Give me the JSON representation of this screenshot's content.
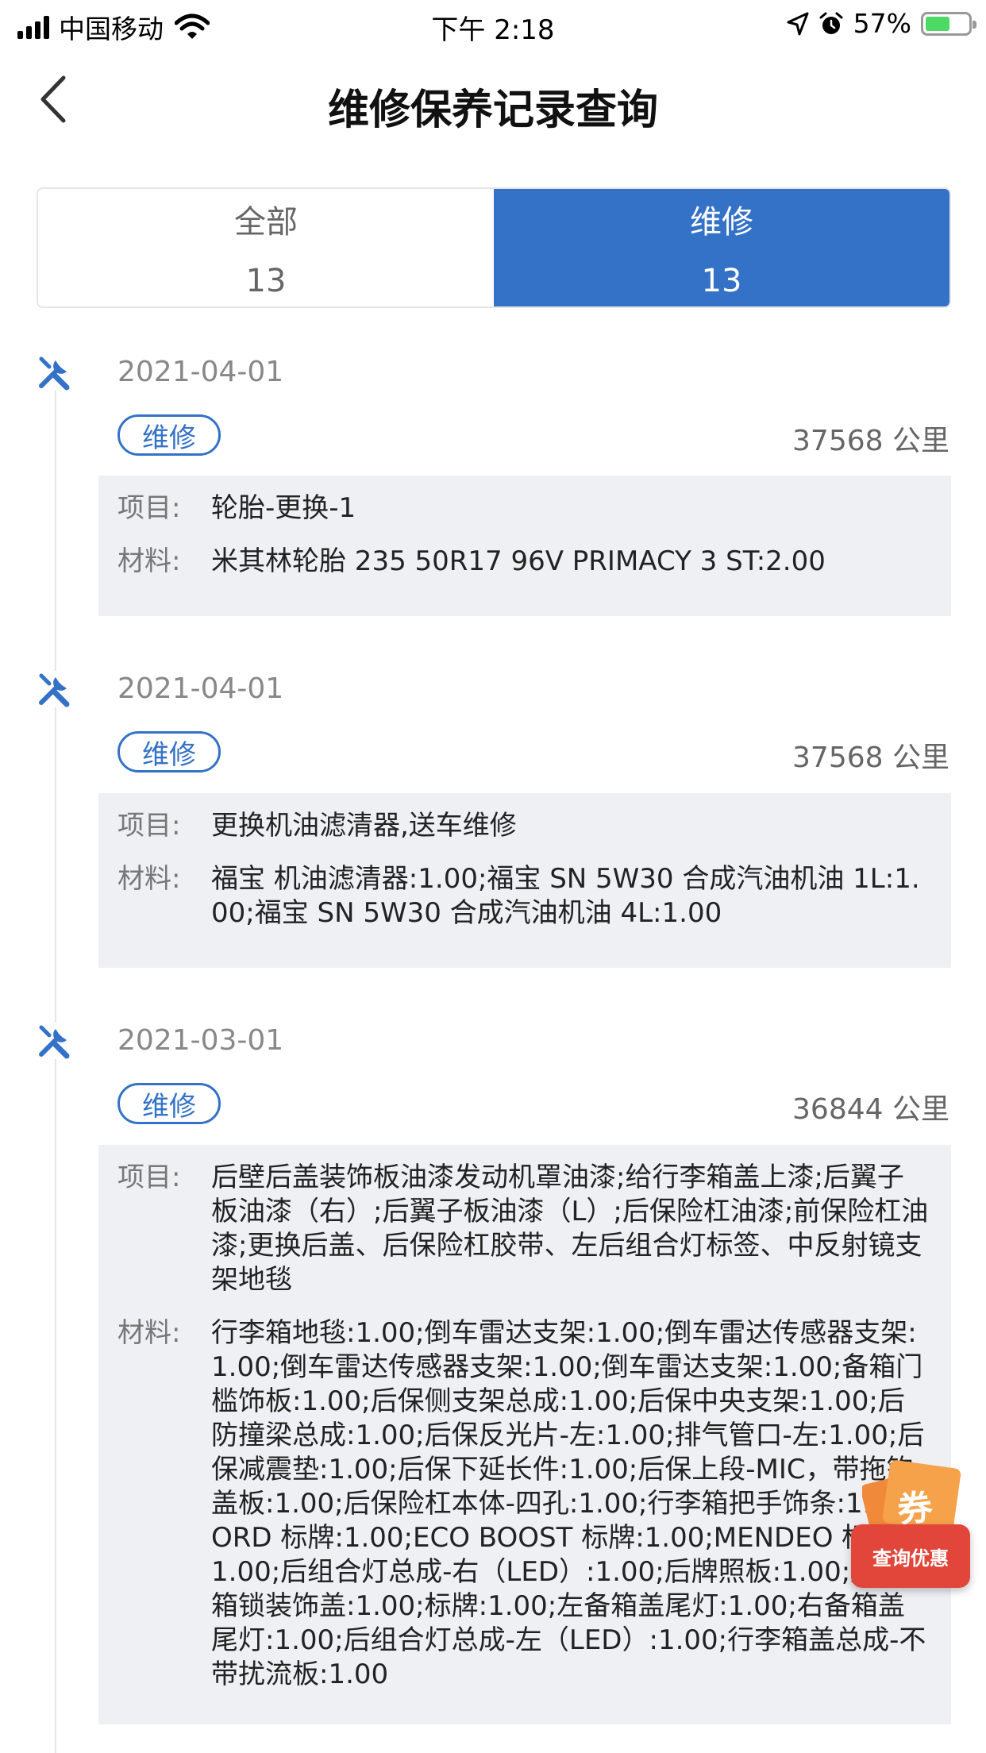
{
  "status_bar": {
    "carrier": "中国移动",
    "time": "下午 2:18",
    "battery": "57%",
    "battery_level": 0.57
  },
  "nav": {
    "title": "维修保养记录查询"
  },
  "tabs": [
    {
      "label": "全部",
      "count": "13",
      "active": false
    },
    {
      "label": "维修",
      "count": "13",
      "active": true
    }
  ],
  "records": [
    {
      "date": "2021-04-01",
      "type": "维修",
      "mileage": "37568 公里",
      "item_label": "项目:",
      "item": "轮胎-更换-1",
      "material_label": "材料:",
      "material": "米其林轮胎 235 50R17 96V PRIMACY 3 ST:2.00"
    },
    {
      "date": "2021-04-01",
      "type": "维修",
      "mileage": "37568 公里",
      "item_label": "项目:",
      "item": "更换机油滤清器,送车维修",
      "material_label": "材料:",
      "material": "福宝 机油滤清器:1.00;福宝 SN 5W30 合成汽油机油 1L:1.00;福宝 SN 5W30 合成汽油机油 4L:1.00"
    },
    {
      "date": "2021-03-01",
      "type": "维修",
      "mileage": "36844 公里",
      "item_label": "项目:",
      "item": "后壁后盖装饰板油漆发动机罩油漆;给行李箱盖上漆;后翼子板油漆（右）;后翼子板油漆（L）;后保险杠油漆;前保险杠油漆;更换后盖、后保险杠胶带、左后组合灯标签、中反射镜支架地毯",
      "material_label": "材料:",
      "material": "行李箱地毯:1.00;倒车雷达支架:1.00;倒车雷达传感器支架:1.00;倒车雷达传感器支架:1.00;倒车雷达支架:1.00;备箱门槛饰板:1.00;后保侧支架总成:1.00;后保中央支架:1.00;后防撞梁总成:1.00;后保反光片-左:1.00;排气管口-左:1.00;后保减震垫:1.00;后保下延长件:1.00;后保上段-MIC，带拖钩盖板:1.00;后保险杠本体-四孔:1.00;行李箱把手饰条:1.00;FORD 标牌:1.00;ECO BOOST 标牌:1.00;MENDEO 标牌:1.00;后组合灯总成-右（LED）:1.00;后牌照板:1.00;后备箱锁装饰盖:1.00;标牌:1.00;左备箱盖尾灯:1.00;右备箱盖尾灯:1.00;后组合灯总成-左（LED）:1.00;行李箱盖总成-不带扰流板:1.00"
    }
  ],
  "coupon": {
    "glyph": "券",
    "label": "查询优惠"
  },
  "colors": {
    "accent": "#3472c7",
    "panel": "#eff0f4",
    "coupon": "#e2453a"
  },
  "icons": [
    "back-arrow-icon",
    "wrench-icon",
    "wifi-icon",
    "location-icon",
    "alarm-icon",
    "battery-icon"
  ]
}
